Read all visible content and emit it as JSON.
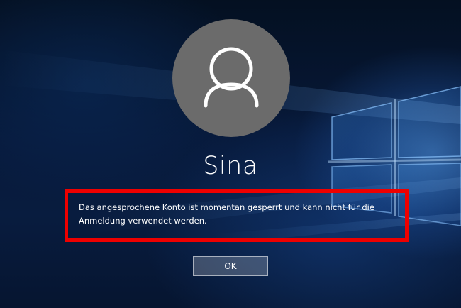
{
  "lock_screen": {
    "user_name": "Sina",
    "error_message": "Das angesprochene Konto ist momentan gesperrt und kann nicht für die Anmeldung verwendet werden.",
    "ok_label": "OK",
    "avatar_icon": "user-silhouette-icon",
    "background_image": "windows-logo-light-beams"
  },
  "colors": {
    "avatar_bg": "#6b6b6b",
    "highlight": "#ee0000",
    "text": "#ffffff",
    "background": "#07193a"
  }
}
